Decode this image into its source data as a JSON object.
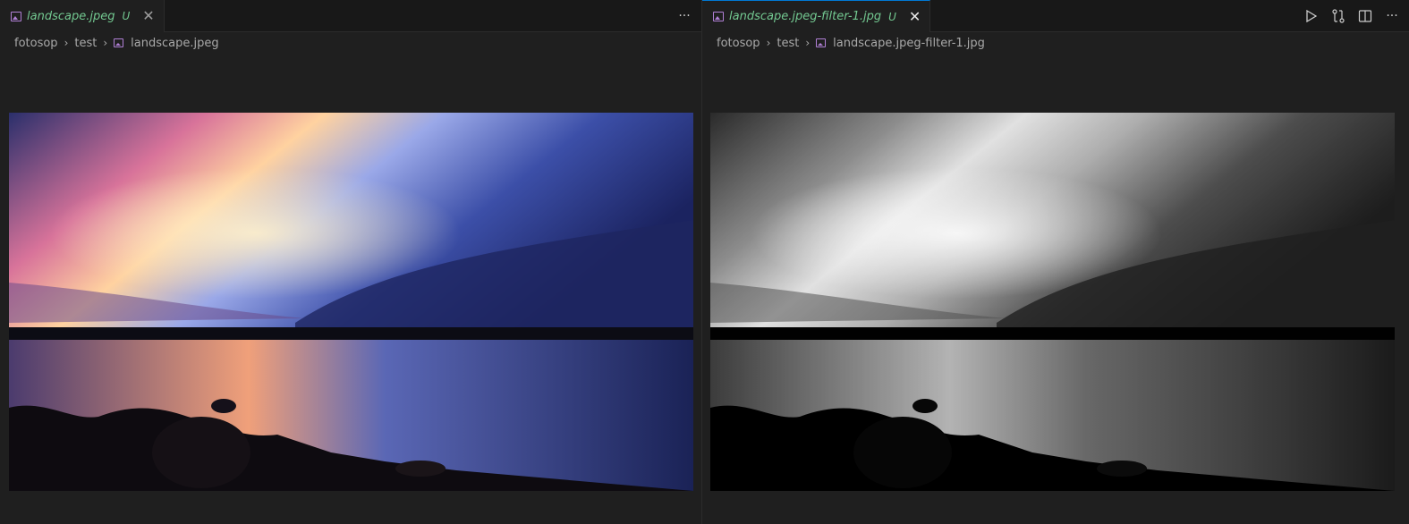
{
  "left_group": {
    "tab": {
      "label": "landscape.jpeg",
      "status": "U"
    },
    "breadcrumb": [
      "fotosop",
      "test",
      "landscape.jpeg"
    ],
    "image": {
      "alt": "landscape.jpeg"
    }
  },
  "right_group": {
    "tab": {
      "label": "landscape.jpeg-filter-1.jpg",
      "status": "U"
    },
    "breadcrumb": [
      "fotosop",
      "test",
      "landscape.jpeg-filter-1.jpg"
    ],
    "image": {
      "alt": "landscape.jpeg-filter-1.jpg"
    }
  },
  "icons": {
    "close": "close-icon",
    "more": "more-actions-icon",
    "run": "run-icon",
    "compare": "compare-changes-icon",
    "split": "split-editor-icon",
    "image_file": "image-file-icon"
  },
  "colors": {
    "background": "#1f1f1f",
    "tabbar": "#181818",
    "modified_text": "#73c991",
    "active_tab_border": "#0078d4",
    "image_icon": "#b180d7"
  }
}
